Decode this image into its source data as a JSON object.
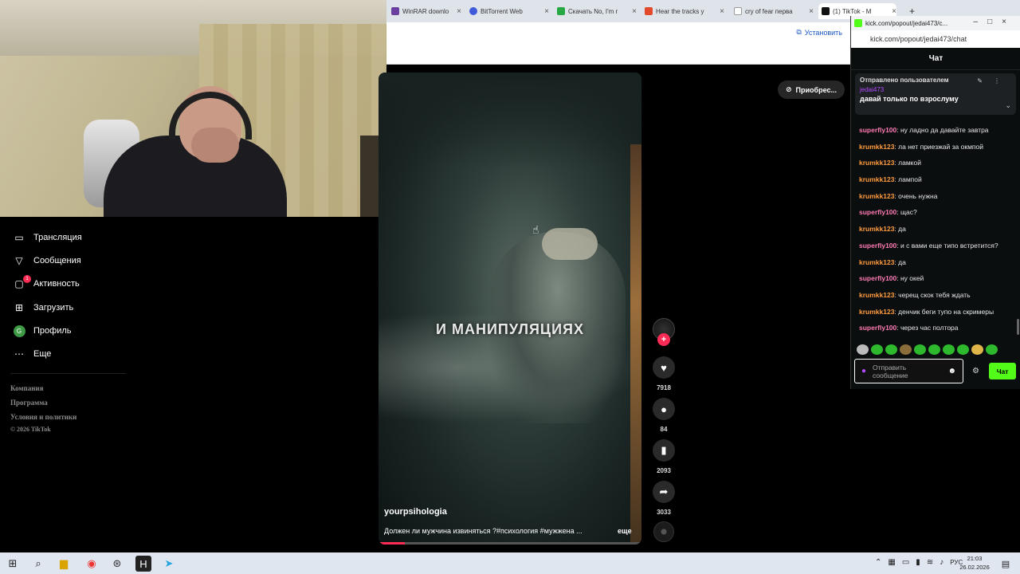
{
  "browser": {
    "tabs": [
      {
        "title": "WinRAR downlo",
        "color": "#6b3fa0"
      },
      {
        "title": "BitTorrent Web",
        "color": "#3f5bd9"
      },
      {
        "title": "Скачать No, I'm r",
        "color": "#27a844"
      },
      {
        "title": "Hear the tracks y",
        "color": "#e34a2b"
      },
      {
        "title": "cry of fear перва",
        "color": "#ffffff"
      },
      {
        "title": "(1) TikTok - M",
        "color": "#111111"
      }
    ],
    "install_label": "Установить"
  },
  "sidebar": {
    "items": [
      {
        "label": "Трансляция",
        "icon": "live-icon"
      },
      {
        "label": "Сообщения",
        "icon": "messages-icon"
      },
      {
        "label": "Активность",
        "icon": "activity-icon",
        "badge": "1"
      },
      {
        "label": "Загрузить",
        "icon": "upload-icon"
      },
      {
        "label": "Профиль",
        "icon": "profile-icon",
        "avatar_letter": "G"
      },
      {
        "label": "Еще",
        "icon": "more-icon"
      }
    ],
    "footer": [
      "Компания",
      "Программа",
      "Условия и политики",
      "© 2026 TikTok"
    ]
  },
  "video": {
    "overlay_text": "И МАНИПУЛЯЦИЯХ",
    "author": "yourpsihologia",
    "description": "Должен ли мужчина извиняться ?#психология #мужжена ...",
    "more_label": "еще",
    "progress": 0.1
  },
  "actions": {
    "likes": "7918",
    "comments": "84",
    "saves": "2093",
    "shares": "3033"
  },
  "buy_button": "Приобрес...",
  "chat": {
    "window_title": "kick.com/popout/jedai473/c...",
    "url": "kick.com/popout/jedai473/chat",
    "header": "Чат",
    "pinned": {
      "by_label": "Отправлено пользователем",
      "user": "jedai473",
      "message": "давай только по взрослуму"
    },
    "messages": [
      {
        "user": "superfly100",
        "text": "ну ладно да давайте завтра",
        "color": "#ff7bb4"
      },
      {
        "user": "krumkk123",
        "text": "ла нет приезжай за окмпой",
        "color": "#ff9b3d"
      },
      {
        "user": "krumkk123",
        "text": "ламкой",
        "color": "#ff9b3d"
      },
      {
        "user": "krumkk123",
        "text": "лампой",
        "color": "#ff9b3d"
      },
      {
        "user": "krumkk123",
        "text": "очень нужна",
        "color": "#ff9b3d"
      },
      {
        "user": "superfly100",
        "text": "щас?",
        "color": "#ff7bb4"
      },
      {
        "user": "krumkk123",
        "text": "да",
        "color": "#ff9b3d"
      },
      {
        "user": "superfly100",
        "text": "и с вами еще типо встретится?",
        "color": "#ff7bb4"
      },
      {
        "user": "krumkk123",
        "text": "да",
        "color": "#ff9b3d"
      },
      {
        "user": "superfly100",
        "text": "ну окей",
        "color": "#ff7bb4"
      },
      {
        "user": "krumkk123",
        "text": "черещ скок тебя ждать",
        "color": "#ff9b3d"
      },
      {
        "user": "krumkk123",
        "text": "денчик беги тупо на скримеры",
        "color": "#ff9b3d"
      },
      {
        "user": "superfly100",
        "text": "через час полтора",
        "color": "#ff7bb4"
      }
    ],
    "input_placeholder": "Отправить сообщение",
    "send_label": "Чат",
    "accent": "#53fc18"
  },
  "taskbar": {
    "language": "РУС",
    "time": "21:03",
    "date": "26.02.2026"
  }
}
